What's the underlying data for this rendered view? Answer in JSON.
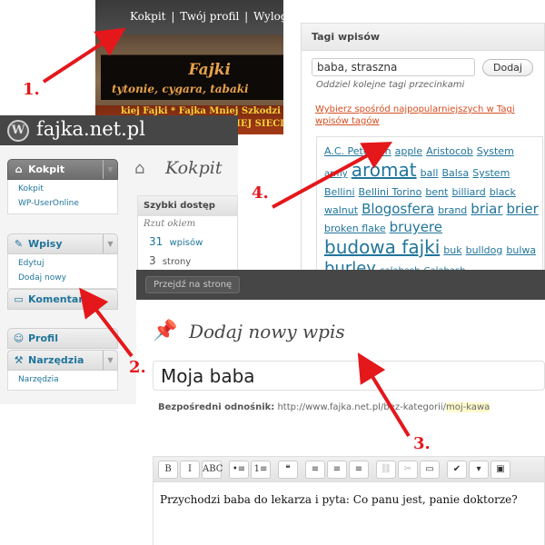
{
  "header": {
    "links": [
      "Kokpit",
      "Twój profil",
      "Wyloguj"
    ],
    "separator": "|",
    "banner_title": "Fajki",
    "banner_subtitle": "tytonie, cygara, tabaki",
    "marquee_line1": "kiej Fajki * Fajka Mniej Szkodzi",
    "marquee_line2": "Y DOROBEK W POLSKIEJ SIECI"
  },
  "admin": {
    "logo_letter": "W",
    "site_name": "fajka.net.pl",
    "site_button": "»",
    "menu": {
      "kokpit": {
        "label": "Kokpit",
        "items": [
          "Kokpit",
          "WP-UserOnline"
        ]
      },
      "wpisy": {
        "label": "Wpisy",
        "items": [
          "Edytuj",
          "Dodaj nowy"
        ]
      },
      "komentarze": {
        "label": "Komentarze"
      },
      "profil": {
        "label": "Profil"
      },
      "narzedzia": {
        "label": "Narzędzia",
        "items": [
          "Narzędzia"
        ]
      }
    },
    "dashboard": {
      "title": "Kokpit",
      "box_title": "Szybki dostęp",
      "box_subtitle": "Rzut okiem",
      "posts_count": "31",
      "posts_label": "wpisów",
      "pages_count": "3",
      "pages_label": "strony"
    }
  },
  "tags": {
    "title": "Tagi wpisów",
    "input_value": "baba, straszna",
    "add_button": "Dodaj",
    "hint": "Oddziel kolejne tagi przecinkami",
    "popular_link": "Wybierz spośród najpopularniejszych w Tagi wpisów tagów",
    "cloud": [
      {
        "text": "A.C. Petersen",
        "size": "s11"
      },
      {
        "text": "apple",
        "size": "s11"
      },
      {
        "text": "Aristocob",
        "size": "s11"
      },
      {
        "text": "System",
        "size": "s11"
      },
      {
        "text": "army",
        "size": "s10"
      },
      {
        "text": "aromat",
        "size": "s20"
      },
      {
        "text": "ball",
        "size": "s11"
      },
      {
        "text": "Balsa",
        "size": "s11"
      },
      {
        "text": "System",
        "size": "s11"
      },
      {
        "text": "Bellini",
        "size": "s11"
      },
      {
        "text": "Bellini Torino",
        "size": "s11"
      },
      {
        "text": "bent",
        "size": "s11"
      },
      {
        "text": "billiard",
        "size": "s11"
      },
      {
        "text": "black",
        "size": "s11"
      },
      {
        "text": "walnut",
        "size": "s11"
      },
      {
        "text": "Blogosfera",
        "size": "s15"
      },
      {
        "text": "brand",
        "size": "s11"
      },
      {
        "text": "briar",
        "size": "s15"
      },
      {
        "text": "brier",
        "size": "s15"
      },
      {
        "text": "broken flake",
        "size": "s11"
      },
      {
        "text": "bruyere",
        "size": "s15"
      },
      {
        "text": "budowa fajki",
        "size": "s20"
      },
      {
        "text": "buk",
        "size": "s11"
      },
      {
        "text": "bulldog",
        "size": "s11"
      },
      {
        "text": "bulwa",
        "size": "s11"
      },
      {
        "text": "burley",
        "size": "s18"
      },
      {
        "text": "calabash",
        "size": "s10"
      },
      {
        "text": "Calabash",
        "size": "s10"
      }
    ]
  },
  "editor": {
    "visit_button": "Przejdź na stronę",
    "page_title": "Dodaj nowy wpis",
    "post_title": "Moja baba",
    "permalink_label": "Bezpośredni odnośnik:",
    "permalink_url": "http://www.fajka.net.pl/bez-kategorii/",
    "permalink_slug": "moj-kawa",
    "toolbar": [
      "B",
      "I",
      "ABC",
      "•≡",
      "1≡",
      "‹›",
      "❝",
      "≡",
      "≡",
      "≡",
      "⛓",
      "✂",
      "▭",
      "✔",
      "▾",
      "▣"
    ],
    "content": "Przychodzi baba do lekarza i pyta: Co panu jest, panie doktorze?"
  },
  "annotations": {
    "labels": [
      "1.",
      "2.",
      "3.",
      "4."
    ],
    "arrow_color": "#e4171b"
  }
}
